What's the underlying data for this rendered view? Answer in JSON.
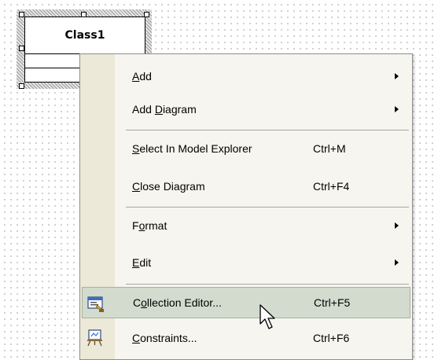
{
  "diagram": {
    "class_name": "Class1"
  },
  "context_menu": {
    "items": [
      {
        "label": "Add",
        "accel": "A",
        "rest": "dd",
        "shortcut": "",
        "submenu": true
      },
      {
        "label": "Add Diagram",
        "pre": "Add ",
        "accel": "D",
        "rest": "iagram",
        "shortcut": "",
        "submenu": true
      },
      {
        "label": "Select In Model Explorer",
        "accel": "S",
        "rest": "elect In Model Explorer",
        "shortcut": "Ctrl+M",
        "submenu": false
      },
      {
        "label": "Close Diagram",
        "accel": "C",
        "rest": "lose Diagram",
        "shortcut": "Ctrl+F4",
        "submenu": false
      },
      {
        "label": "Format",
        "pre": "F",
        "accel": "o",
        "rest": "rmat",
        "shortcut": "",
        "submenu": true
      },
      {
        "label": "Edit",
        "accel": "E",
        "rest": "dit",
        "shortcut": "",
        "submenu": true
      },
      {
        "label": "Collection Editor...",
        "pre": "C",
        "accel": "o",
        "rest": "llection Editor...",
        "shortcut": "Ctrl+F5",
        "submenu": false,
        "highlighted": true,
        "icon": "collection-editor-icon"
      },
      {
        "label": "Constraints...",
        "accel": "C",
        "rest": "onstraints...",
        "shortcut": "Ctrl+F6",
        "submenu": false,
        "icon": "constraints-icon"
      }
    ]
  },
  "colors": {
    "menu_background": "#f6f5ef",
    "menu_gutter": "#ece9d8",
    "highlight": "#d3dbce"
  }
}
